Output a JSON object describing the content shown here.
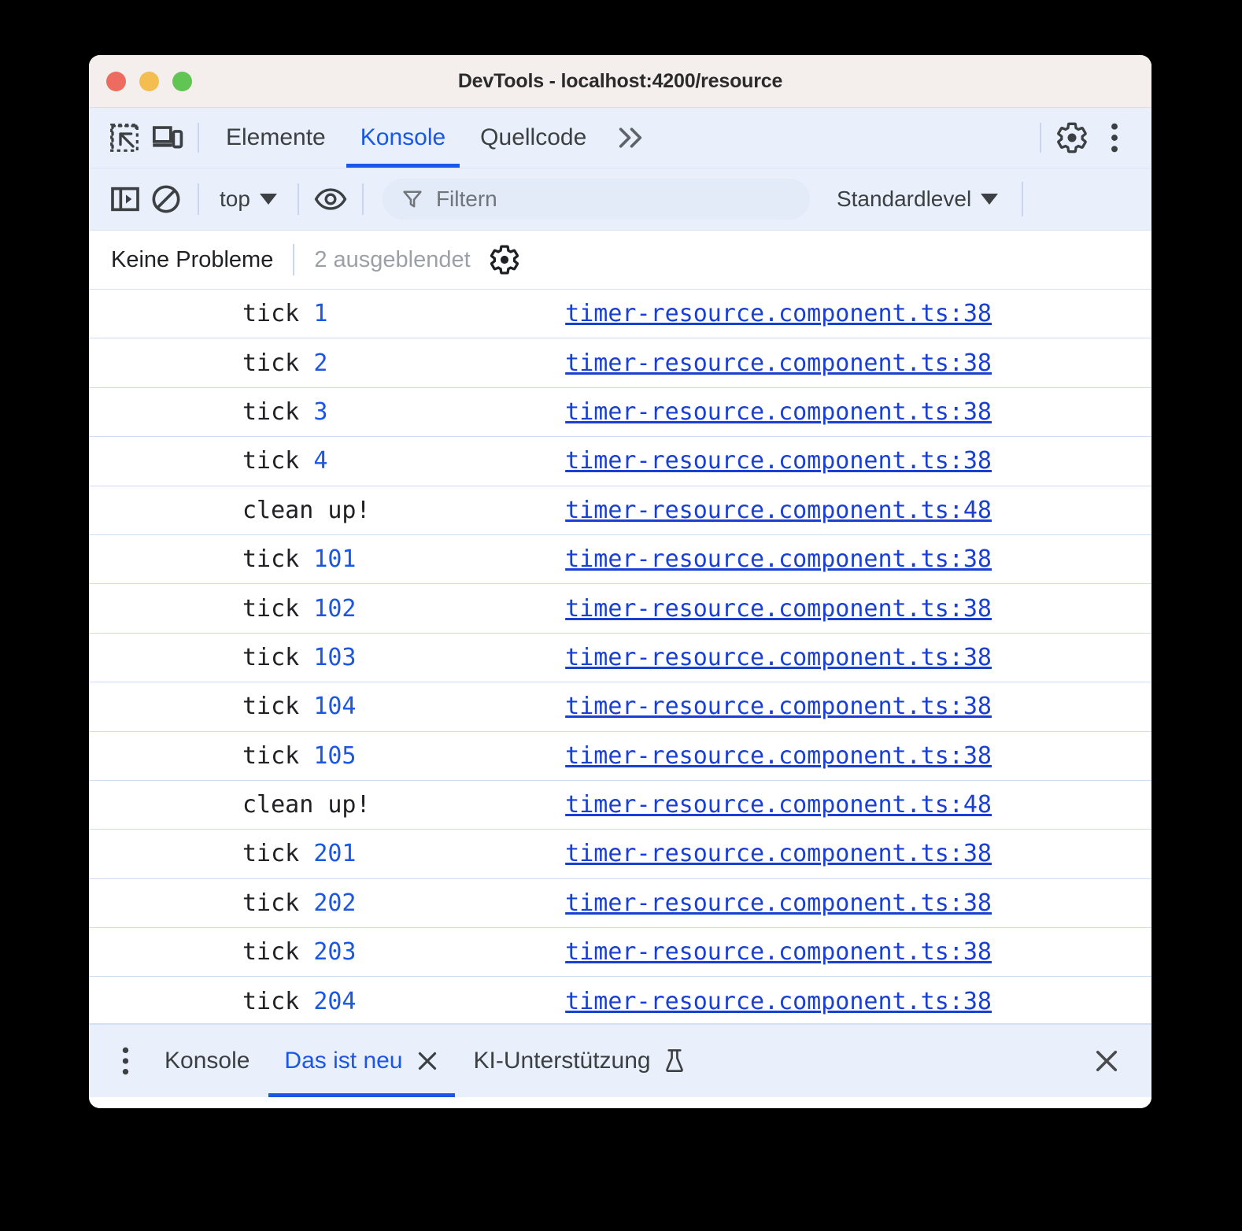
{
  "window": {
    "title": "DevTools - localhost:4200/resource",
    "traffic_lights": [
      {
        "name": "close",
        "color": "#ed6b5f"
      },
      {
        "name": "minimize",
        "color": "#f4bd4f"
      },
      {
        "name": "maximize",
        "color": "#61c554"
      }
    ]
  },
  "main_tabbar": {
    "icons": [
      {
        "name": "inspect-element-icon"
      },
      {
        "name": "device-toolbar-icon"
      }
    ],
    "tabs": [
      {
        "label": "Elemente",
        "active": false
      },
      {
        "label": "Konsole",
        "active": true
      },
      {
        "label": "Quellcode",
        "active": false
      }
    ],
    "more_label": "»",
    "settings_icon": "gear-icon",
    "menu_icon": "kebab-menu-icon"
  },
  "console_toolbar": {
    "sidebar_toggle_icon": "console-sidebar-icon",
    "clear_icon": "clear-console-icon",
    "context_label": "top",
    "live_expression_icon": "eye-icon",
    "filter_placeholder": "Filtern",
    "filter_value": "",
    "filter_icon": "filter-funnel-icon",
    "level_label": "Standardlevel"
  },
  "status_strip": {
    "issues_label": "Keine Probleme",
    "hidden_label": "2 ausgeblendet",
    "settings_icon": "gear-icon"
  },
  "console_messages": [
    {
      "text": "tick ",
      "value": "1",
      "source": "timer-resource.component.ts:38"
    },
    {
      "text": "tick ",
      "value": "2",
      "source": "timer-resource.component.ts:38"
    },
    {
      "text": "tick ",
      "value": "3",
      "source": "timer-resource.component.ts:38"
    },
    {
      "text": "tick ",
      "value": "4",
      "source": "timer-resource.component.ts:38"
    },
    {
      "text": "clean up!",
      "value": "",
      "source": "timer-resource.component.ts:48"
    },
    {
      "text": "tick ",
      "value": "101",
      "source": "timer-resource.component.ts:38"
    },
    {
      "text": "tick ",
      "value": "102",
      "source": "timer-resource.component.ts:38"
    },
    {
      "text": "tick ",
      "value": "103",
      "source": "timer-resource.component.ts:38"
    },
    {
      "text": "tick ",
      "value": "104",
      "source": "timer-resource.component.ts:38"
    },
    {
      "text": "tick ",
      "value": "105",
      "source": "timer-resource.component.ts:38"
    },
    {
      "text": "clean up!",
      "value": "",
      "source": "timer-resource.component.ts:48"
    },
    {
      "text": "tick ",
      "value": "201",
      "source": "timer-resource.component.ts:38"
    },
    {
      "text": "tick ",
      "value": "202",
      "source": "timer-resource.component.ts:38"
    },
    {
      "text": "tick ",
      "value": "203",
      "source": "timer-resource.component.ts:38"
    },
    {
      "text": "tick ",
      "value": "204",
      "source": "timer-resource.component.ts:38"
    }
  ],
  "drawer": {
    "kebab_icon": "kebab-menu-icon",
    "tabs": [
      {
        "label": "Konsole",
        "active": false,
        "closable": false,
        "experiment": false
      },
      {
        "label": "Das ist neu",
        "active": true,
        "closable": true,
        "experiment": false
      },
      {
        "label": "KI-Unterstützung",
        "active": false,
        "closable": false,
        "experiment": true
      }
    ],
    "close_icon": "close-icon"
  },
  "colors": {
    "accent": "#1a56e8",
    "link": "#1a3fd4",
    "toolbar_bg": "#eaf0fb",
    "titlebar_bg": "#f4efec",
    "row_separator": "#cddcf5",
    "muted_text": "#9aa0a6"
  }
}
